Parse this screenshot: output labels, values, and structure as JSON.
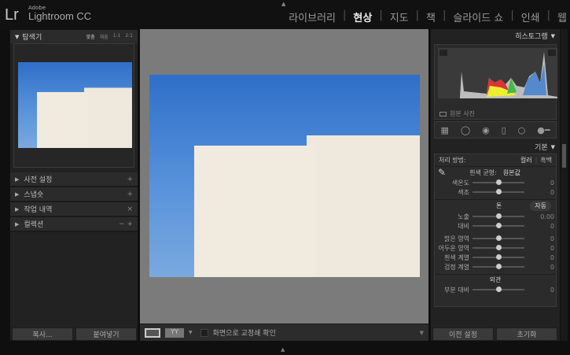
{
  "app": {
    "brand_small": "Adobe",
    "brand": "Lightroom CC",
    "logo": "Lr"
  },
  "modules": [
    {
      "label": "라이브러리"
    },
    {
      "label": "현상",
      "active": true
    },
    {
      "label": "지도"
    },
    {
      "label": "책"
    },
    {
      "label": "슬라이드 쇼"
    },
    {
      "label": "인쇄"
    },
    {
      "label": "웹"
    }
  ],
  "navigator": {
    "title": "탐색기",
    "zoom_options": [
      "맞춤",
      "채움",
      "1:1",
      "2:1"
    ]
  },
  "left_sections": [
    {
      "label": "사전 설정",
      "action": "+"
    },
    {
      "label": "스냅숏",
      "action": "+"
    },
    {
      "label": "작업 내역",
      "action": "×"
    },
    {
      "label": "컬렉션",
      "action": "− +"
    }
  ],
  "left_buttons": {
    "copy": "복사...",
    "paste": "붙여넣기"
  },
  "toolbar": {
    "softproof_label": "화면으로 교정쇄 확인",
    "softproof_checked": false
  },
  "histogram": {
    "title": "히스토그램",
    "original_photo": "원본 사진",
    "original_checked": false
  },
  "basic": {
    "title": "기본",
    "treatment_label": "처리 방법:",
    "color": "컬러",
    "bw": "흑백",
    "wb_label": "흰색 균형:",
    "wb_value": "원본값",
    "tone_title": "톤",
    "auto": "자동",
    "presence_title": "외관",
    "sliders": [
      {
        "label": "색온도",
        "value": "0",
        "pos": 0.5
      },
      {
        "label": "색조",
        "value": "0",
        "pos": 0.5
      },
      {
        "label": "노출",
        "value": "0.00",
        "pos": 0.5
      },
      {
        "label": "대비",
        "value": "0",
        "pos": 0.5
      },
      {
        "label": "밝은 영역",
        "value": "0",
        "pos": 0.5
      },
      {
        "label": "어두운 영역",
        "value": "0",
        "pos": 0.5
      },
      {
        "label": "흰색 계열",
        "value": "0",
        "pos": 0.5
      },
      {
        "label": "검정 계열",
        "value": "0",
        "pos": 0.5
      },
      {
        "label": "부분 대비",
        "value": "0",
        "pos": 0.5
      }
    ]
  },
  "right_buttons": {
    "previous": "이전 설정",
    "reset": "초기화"
  }
}
